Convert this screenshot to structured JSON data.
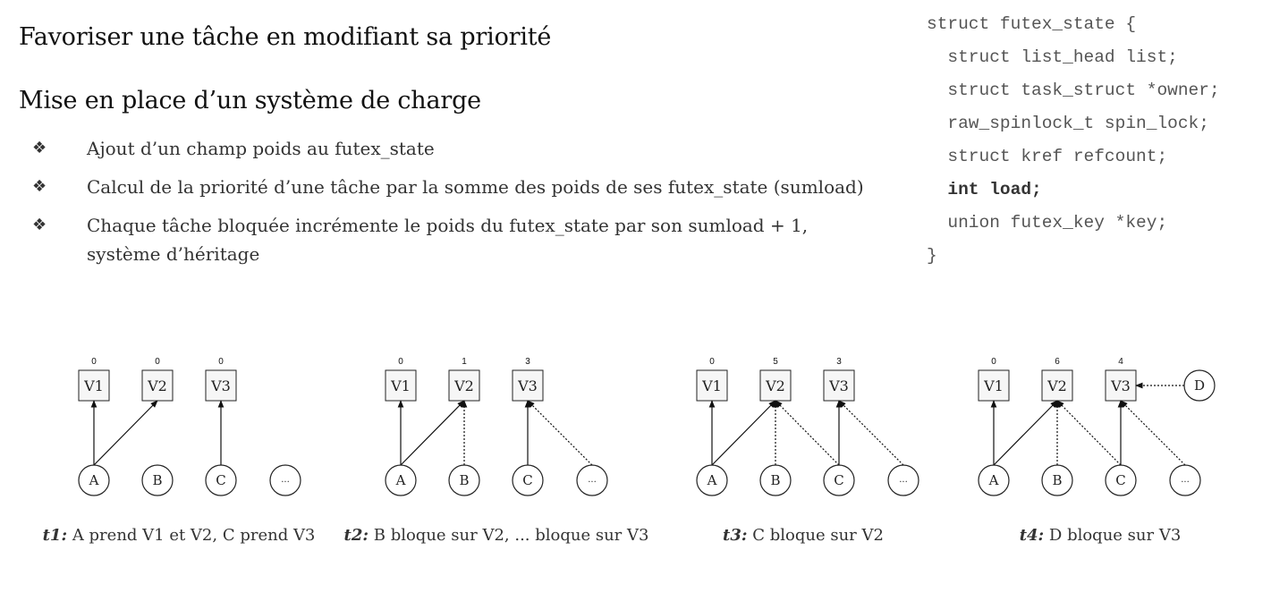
{
  "titles": {
    "t1": "Favoriser une tâche en modifiant sa priorité",
    "t2": "Mise en place d’un système de charge"
  },
  "bullets": [
    "Ajout d’un champ poids au futex_state",
    "Calcul de la priorité d’une tâche par la somme des poids de ses futex_state (sumload)",
    "Chaque tâche bloquée incrémente le poids du futex_state par son sumload + 1,",
    "système d’héritage"
  ],
  "bullet_symbol": "❖",
  "code": {
    "lines": [
      "struct futex_state {",
      "  struct list_head list;",
      "  struct task_struct *owner;",
      "  raw_spinlock_t spin_lock;",
      "  struct kref refcount;",
      "  int load;",
      "  union futex_key *key;",
      "}"
    ],
    "bold_line_index": 5
  },
  "diagrams": [
    {
      "id": "t1",
      "resources": [
        {
          "label": "V1",
          "weight": "0"
        },
        {
          "label": "V2",
          "weight": "0"
        },
        {
          "label": "V3",
          "weight": "0"
        }
      ],
      "tasks": [
        "A",
        "B",
        "C",
        "..."
      ],
      "extra_task": null,
      "holds": [
        [
          "A",
          "V1"
        ],
        [
          "A",
          "V2"
        ],
        [
          "C",
          "V3"
        ]
      ],
      "blocks": [],
      "caption_label": "t1:",
      "caption_text": " A prend V1 et V2, C prend V3"
    },
    {
      "id": "t2",
      "resources": [
        {
          "label": "V1",
          "weight": "0"
        },
        {
          "label": "V2",
          "weight": "1"
        },
        {
          "label": "V3",
          "weight": "3"
        }
      ],
      "tasks": [
        "A",
        "B",
        "C",
        "..."
      ],
      "extra_task": null,
      "holds": [
        [
          "A",
          "V1"
        ],
        [
          "A",
          "V2"
        ],
        [
          "C",
          "V3"
        ]
      ],
      "blocks": [
        [
          "B",
          "V2"
        ],
        [
          "...",
          "V3"
        ]
      ],
      "caption_label": "t2:",
      "caption_text": " B bloque sur V2, ... bloque sur V3"
    },
    {
      "id": "t3",
      "resources": [
        {
          "label": "V1",
          "weight": "0"
        },
        {
          "label": "V2",
          "weight": "5"
        },
        {
          "label": "V3",
          "weight": "3"
        }
      ],
      "tasks": [
        "A",
        "B",
        "C",
        "..."
      ],
      "extra_task": null,
      "holds": [
        [
          "A",
          "V1"
        ],
        [
          "A",
          "V2"
        ],
        [
          "C",
          "V3"
        ]
      ],
      "blocks": [
        [
          "B",
          "V2"
        ],
        [
          "C",
          "V2"
        ],
        [
          "...",
          "V3"
        ]
      ],
      "caption_label": "t3:",
      "caption_text": " C bloque sur V2"
    },
    {
      "id": "t4",
      "resources": [
        {
          "label": "V1",
          "weight": "0"
        },
        {
          "label": "V2",
          "weight": "6"
        },
        {
          "label": "V3",
          "weight": "4"
        }
      ],
      "tasks": [
        "A",
        "B",
        "C",
        "..."
      ],
      "extra_task": "D",
      "holds": [
        [
          "A",
          "V1"
        ],
        [
          "A",
          "V2"
        ],
        [
          "C",
          "V3"
        ]
      ],
      "blocks": [
        [
          "B",
          "V2"
        ],
        [
          "C",
          "V2"
        ],
        [
          "...",
          "V3"
        ],
        [
          "D",
          "V3"
        ]
      ],
      "caption_label": "t4:",
      "caption_text": " D bloque sur V3"
    }
  ]
}
